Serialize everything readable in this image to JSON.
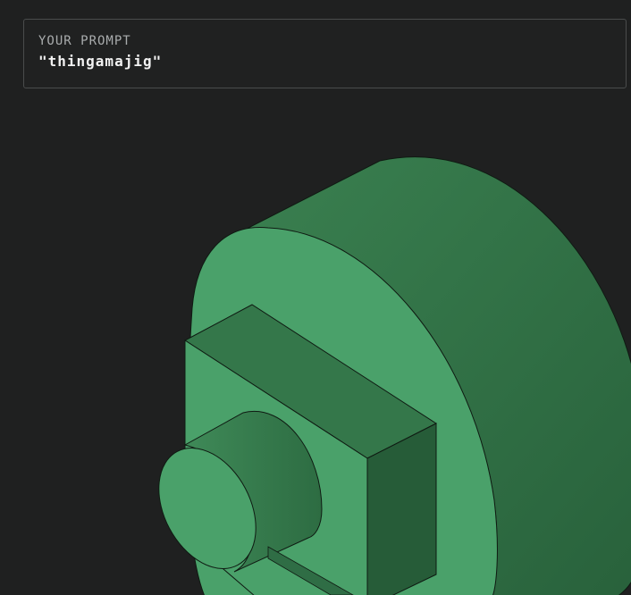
{
  "prompt": {
    "label": "YOUR PROMPT",
    "value": "\"thingamajig\""
  },
  "model": {
    "icon": "cad-part-render",
    "colors": {
      "background": "#1f2020",
      "face_light": "#4aa16a",
      "face_mid": "#34774a",
      "face_dark": "#255a37",
      "outline": "#0f1a12"
    }
  }
}
